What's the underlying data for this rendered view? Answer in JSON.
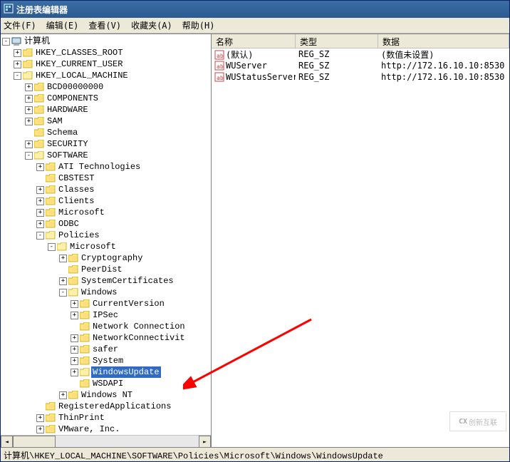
{
  "window": {
    "title": "注册表编辑器"
  },
  "menu": {
    "file": "文件(F)",
    "edit": "编辑(E)",
    "view": "查看(V)",
    "fav": "收藏夹(A)",
    "help": "帮助(H)"
  },
  "tree": {
    "root": "计算机",
    "hkcr": "HKEY_CLASSES_ROOT",
    "hkcu": "HKEY_CURRENT_USER",
    "hklm": "HKEY_LOCAL_MACHINE",
    "bcd": "BCD00000000",
    "components": "COMPONENTS",
    "hardware": "HARDWARE",
    "sam": "SAM",
    "schema": "Schema",
    "security": "SECURITY",
    "software": "SOFTWARE",
    "ati": "ATI Technologies",
    "cbstest": "CBSTEST",
    "classes": "Classes",
    "clients": "Clients",
    "microsoft": "Microsoft",
    "odbc": "ODBC",
    "policies": "Policies",
    "pmicrosoft": "Microsoft",
    "crypto": "Cryptography",
    "peerdist": "PeerDist",
    "syscert": "SystemCertificates",
    "windows": "Windows",
    "curver": "CurrentVersion",
    "ipsec": "IPSec",
    "netconn": "Network Connection",
    "netconnv": "NetworkConnectivit",
    "safer": "safer",
    "system": "System",
    "wupdate": "WindowsUpdate",
    "wsdapi": "WSDAPI",
    "winnt": "Windows NT",
    "regapps": "RegisteredApplications",
    "thinprint": "ThinPrint",
    "vmware": "VMware, Inc."
  },
  "columns": {
    "name_w": 118,
    "type_w": 116,
    "data_w": 180,
    "name": "名称",
    "type": "类型",
    "data": "数据"
  },
  "values": [
    {
      "name": "(默认)",
      "type": "REG_SZ",
      "data": "(数值未设置)"
    },
    {
      "name": "WUServer",
      "type": "REG_SZ",
      "data": "http://172.16.10.10:8530"
    },
    {
      "name": "WUStatusServer",
      "type": "REG_SZ",
      "data": "http://172.16.10.10:8530"
    }
  ],
  "statusbar": "计算机\\HKEY_LOCAL_MACHINE\\SOFTWARE\\Policies\\Microsoft\\Windows\\WindowsUpdate",
  "watermark": "创新互联"
}
